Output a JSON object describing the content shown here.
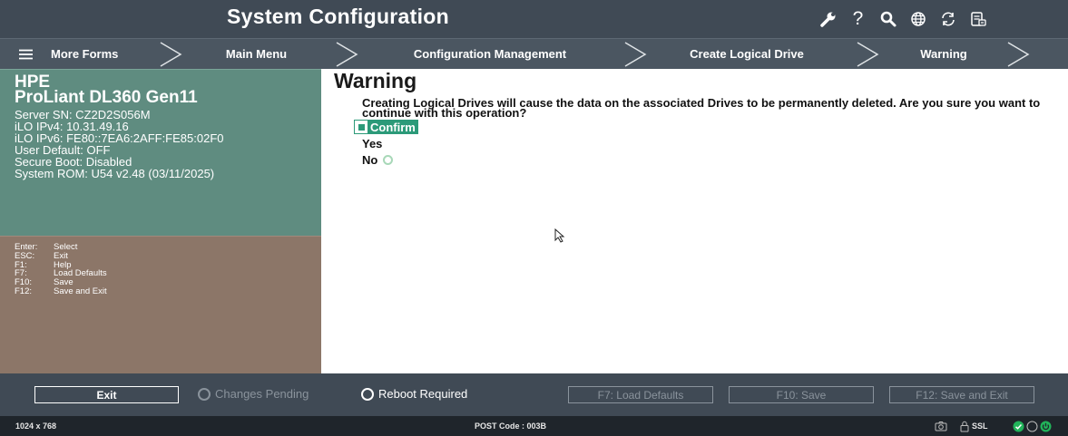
{
  "header": {
    "title": "System Configuration",
    "icons": [
      "wrench-icon",
      "help-icon",
      "search-icon",
      "globe-icon",
      "refresh-icon",
      "save-icon"
    ],
    "help_glyph": "?"
  },
  "breadcrumb": {
    "menu_label": "More Forms",
    "items": [
      "Main Menu",
      "Configuration Management",
      "Create Logical Drive",
      "Warning"
    ]
  },
  "server_info": {
    "brand": "HPE",
    "model": "ProLiant DL360 Gen11",
    "lines": [
      "Server SN: CZ2D2S056M",
      "iLO IPv4: 10.31.49.16",
      "iLO IPv6: FE80::7EA6:2AFF:FE85:02F0",
      "User Default: OFF",
      "Secure Boot: Disabled",
      "System ROM: U54 v2.48 (03/11/2025)"
    ]
  },
  "help_keys": [
    {
      "key": "Enter:",
      "action": "Select"
    },
    {
      "key": "ESC:",
      "action": "Exit"
    },
    {
      "key": "F1:",
      "action": "Help"
    },
    {
      "key": "F7:",
      "action": "Load Defaults"
    },
    {
      "key": "F10:",
      "action": "Save"
    },
    {
      "key": "F12:",
      "action": "Save and Exit"
    }
  ],
  "main": {
    "heading": "Warning",
    "message": "Creating Logical Drives will cause the data on the associated Drives to be permanently deleted. Are you sure you want to continue with this operation?",
    "confirm_label": "Confirm",
    "options": [
      {
        "label": "Yes",
        "selected": false
      },
      {
        "label": "No",
        "selected": true
      }
    ]
  },
  "footer": {
    "exit_label": "Exit",
    "changes_pending": "Changes Pending",
    "reboot_required": "Reboot Required",
    "load_defaults": "F7: Load Defaults",
    "save": "F10: Save",
    "save_exit": "F12: Save and Exit"
  },
  "status_bar": {
    "resolution": "1024 x 768",
    "post_code": "POST Code : 003B",
    "ssl": "SSL"
  },
  "colors": {
    "header_bg": "#404a55",
    "info_panel": "#5f8c80",
    "help_panel": "#8c7668",
    "accent_green": "#2c9a79"
  }
}
